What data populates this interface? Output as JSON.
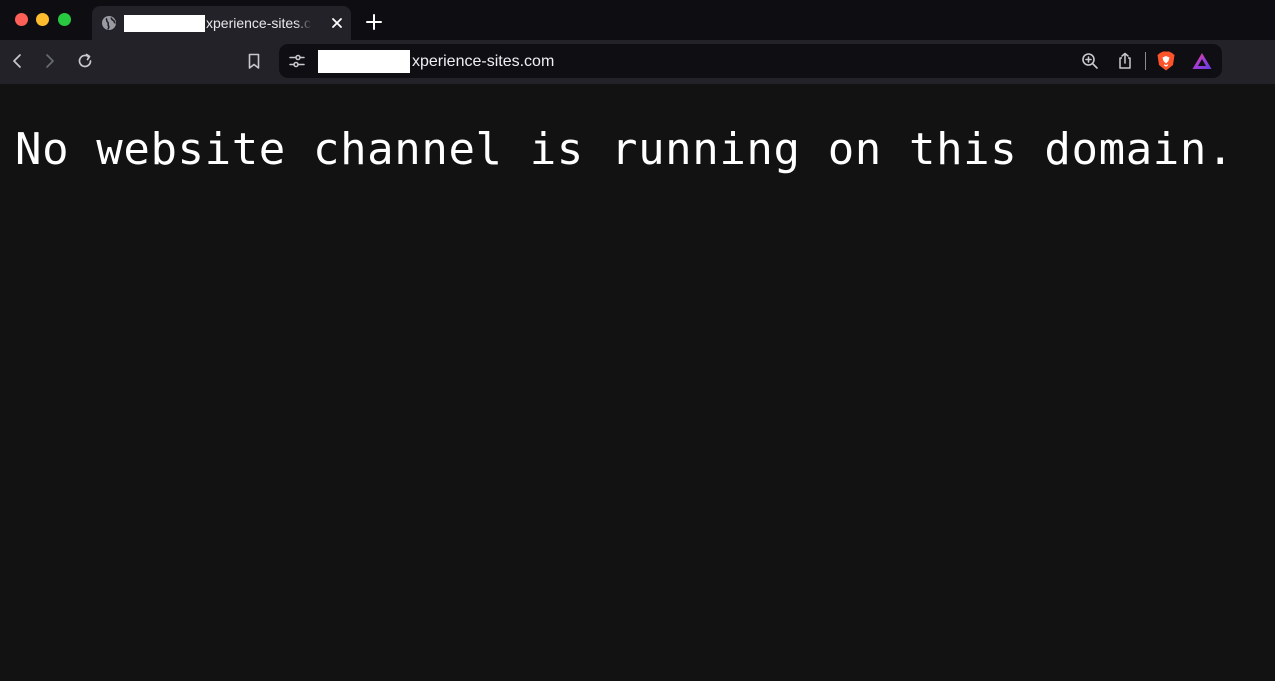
{
  "tab": {
    "title": "xperience-sites.com",
    "favicon": "globe-icon"
  },
  "address_bar": {
    "url": "xperience-sites.com"
  },
  "page": {
    "message": "No website channel is running on this domain."
  },
  "colors": {
    "window_bg": "#0d0d12",
    "toolbar_bg": "#222228",
    "page_bg": "#121212",
    "traffic_red": "#fe5f57",
    "traffic_yellow": "#febc2e",
    "traffic_green": "#28c840",
    "brave_orange": "#fb542b"
  }
}
